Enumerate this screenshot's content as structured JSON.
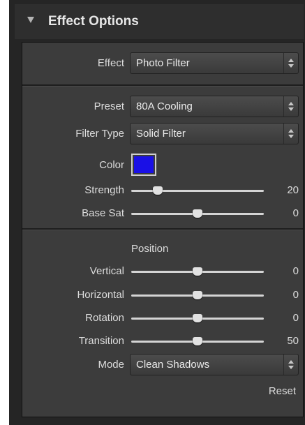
{
  "header": {
    "title": "Effect Options"
  },
  "effect": {
    "label": "Effect",
    "value": "Photo Filter"
  },
  "preset": {
    "label": "Preset",
    "value": "80A Cooling"
  },
  "filter_type": {
    "label": "Filter Type",
    "value": "Solid Filter"
  },
  "color": {
    "label": "Color",
    "value": "#1a10e6"
  },
  "strength": {
    "label": "Strength",
    "value": "20",
    "fraction": 0.2
  },
  "base_sat": {
    "label": "Base Sat",
    "value": "0",
    "fraction": 0.5
  },
  "position": {
    "title": "Position",
    "vertical": {
      "label": "Vertical",
      "value": "0",
      "fraction": 0.5
    },
    "horizontal": {
      "label": "Horizontal",
      "value": "0",
      "fraction": 0.5
    },
    "rotation": {
      "label": "Rotation",
      "value": "0",
      "fraction": 0.5
    },
    "transition": {
      "label": "Transition",
      "value": "50",
      "fraction": 0.5
    }
  },
  "mode": {
    "label": "Mode",
    "value": "Clean Shadows"
  },
  "reset_label": "Reset",
  "icons": {
    "collapse": "triangle-down-icon",
    "spinner": "up-down-arrows-icon"
  }
}
